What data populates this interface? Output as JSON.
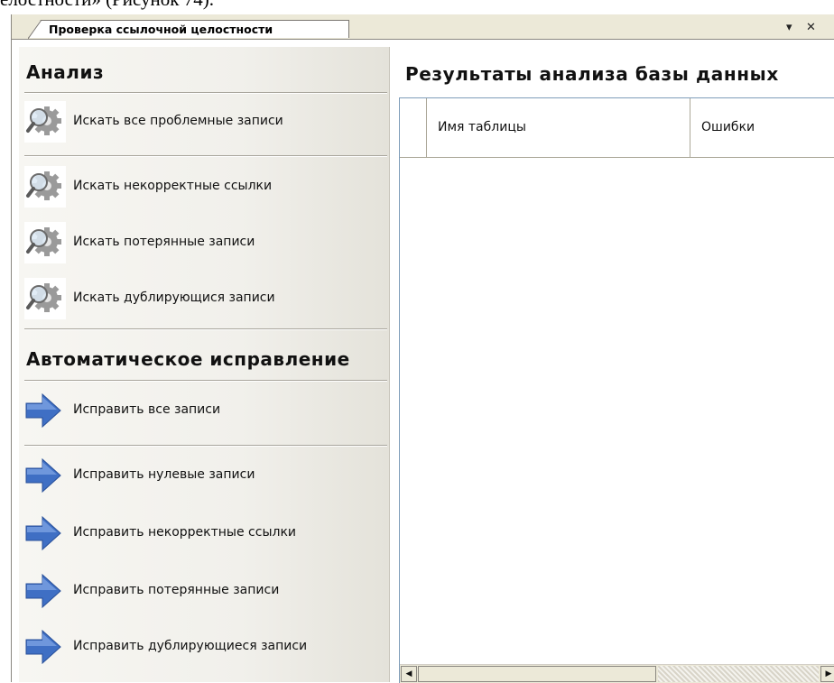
{
  "document_fragment": "елостности» (Рисунок 74).",
  "tab": {
    "title": "Проверка ссылочной целостности",
    "menu_glyph": "▾",
    "close_glyph": "✕"
  },
  "analysis": {
    "heading": "Анализ",
    "items": [
      {
        "label": "Искать все проблемные записи",
        "icon": "gear-magnifier-icon"
      },
      {
        "label": "Искать некорректные ссылки",
        "icon": "gear-magnifier-icon"
      },
      {
        "label": "Искать потерянные записи",
        "icon": "gear-magnifier-icon"
      },
      {
        "label": "Искать дублирующися записи",
        "icon": "gear-magnifier-icon"
      }
    ]
  },
  "auto_fix": {
    "heading": "Автоматическое исправление",
    "items": [
      {
        "label": "Исправить все записи",
        "icon": "blue-arrow-right-icon"
      },
      {
        "label": "Исправить нулевые записи",
        "icon": "blue-arrow-right-icon"
      },
      {
        "label": "Исправить некорректные ссылки",
        "icon": "blue-arrow-right-icon"
      },
      {
        "label": "Исправить потерянные записи",
        "icon": "blue-arrow-right-icon"
      },
      {
        "label": "Исправить дублирующиеся записи",
        "icon": "blue-arrow-right-icon"
      }
    ]
  },
  "results": {
    "title": "Результаты анализа базы данных",
    "columns": [
      "Имя таблицы",
      "Ошибки"
    ],
    "rows": []
  },
  "colors": {
    "arrow_blue": "#3f6fc4",
    "panel_bg": "#f1f0eb",
    "tab_bar": "#ece9d8"
  }
}
